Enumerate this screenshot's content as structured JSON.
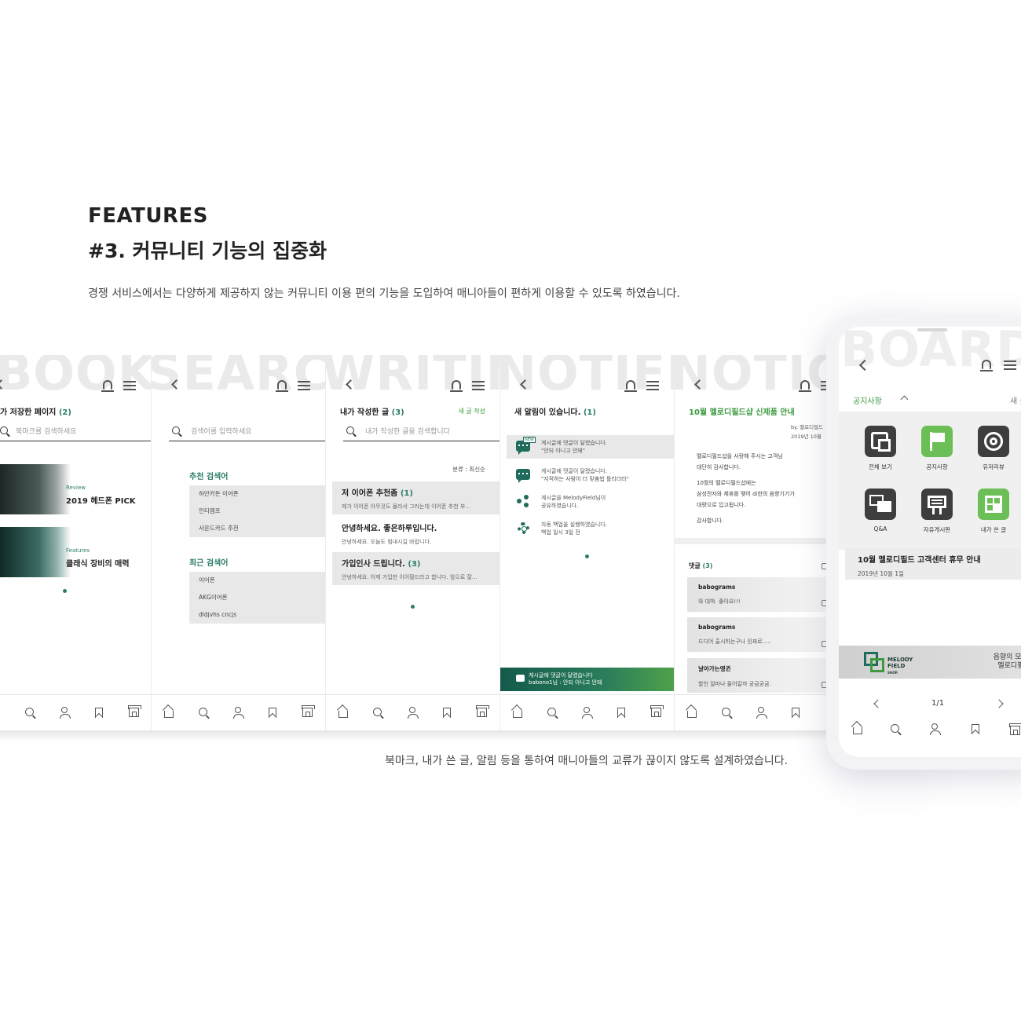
{
  "header": {
    "eyebrow": "FEATURES",
    "title": "#3. 커뮤니티 기능의 집중화",
    "description": "경쟁 서비스에서는 다양하게 제공하지 않는 커뮤니티 이용 편의 기능을 도입하여 매니아들이 편하게 이용할 수 있도록 하였습니다."
  },
  "footer": {
    "description": "북마크, 내가 쓴 글, 알림 등을 통하여 매니아들의 교류가 끊이지 않도록 설계하였습니다."
  },
  "colors": {
    "accent_teal": "#2e7d6b",
    "accent_green": "#3d9a3f",
    "icon_dark": "#3e3e3e",
    "icon_green": "#6cbf56"
  },
  "screens": {
    "bookmark": {
      "bg_word": "BOOKM",
      "title_prefix": "가 저장한 페이지",
      "title_count": "(2)",
      "search_placeholder": "북마크를 검색하세요",
      "cards": [
        {
          "category": "Review",
          "title": "2019 헤드폰 PICK"
        },
        {
          "category": "Features",
          "title": "클래식 장비의 매력"
        }
      ]
    },
    "search": {
      "bg_word": "SEARCH",
      "search_placeholder": "검색어를 입력하세요",
      "recommended_head": "추천 검색어",
      "recommended": [
        "하만카돈 이어폰",
        "인티앰프",
        "사운드카드 추천"
      ],
      "recent_head": "최근 검색어",
      "recent": [
        "이어폰",
        "AKG이어폰",
        "dldjvhs cncjs"
      ]
    },
    "writing": {
      "bg_word": "WRITING",
      "title_prefix": "내가 작성한 글",
      "title_count": "(3)",
      "new_post": "새 글 작성",
      "search_placeholder": "내가 작성한 글을 검색합니다",
      "sort": "분류 : 최신순",
      "posts": [
        {
          "title": "저 이어폰 추천좀",
          "count": "(1)",
          "body": "제가 이어폰 아무것도 몰라서 그러는데 이어폰 추천 부..."
        },
        {
          "title": "안녕하세요. 좋은하루입니다.",
          "count": "",
          "body": "안녕하세요. 오늘도 힘내시길 바랍니다."
        },
        {
          "title": "가입인사 드립니다.",
          "count": "(3)",
          "body": "안녕하세요. 어제 가입한 이어필드라고 합니다. 앞으로 잘..."
        }
      ]
    },
    "notification": {
      "bg_word": "NOTIFICA",
      "title_prefix": "새 알림이 있습니다.",
      "title_count": "(1)",
      "new_tag": "NEW",
      "items": [
        {
          "icon": "comment-bubble-icon",
          "line1": "게시글에 댓글이 달렸습니다.",
          "line2": "\"안되 아니고 안돼\""
        },
        {
          "icon": "comment-bubble-icon",
          "line1": "게시글에 댓글이 달렸습니다.",
          "line2": "\"지적하는 사람이 더 맞춤법 틀리더라\""
        },
        {
          "icon": "share-icon",
          "line1": "게시글을 MelodyField님이",
          "line2": "공유하였습니다."
        },
        {
          "icon": "gear-icon",
          "line1": "자동 백업을 실행하였습니다.",
          "line2": "백업 일시 3일 전"
        }
      ],
      "toast_line1": "게시글에 댓글이 달렸습니다",
      "toast_line2": "babono1님 : 안되 아니고 안돼"
    },
    "notice": {
      "bg_word": "NOTICE",
      "title": "10월 멜로디필드샵 신제품 안내",
      "by": "by. 멜로디필드",
      "date": "2019년 10월",
      "body": [
        "멜로디필드샵을 사랑해 주시는 고객님",
        "대단히 감사합니다.",
        "",
        "10월의 멜로디필드샵에는",
        "삼성전자와 제휴를 맺어 di한의 음향기기가",
        "대량으로 입고됩니다.",
        "",
        "감사합니다."
      ],
      "comments_head": "댓글",
      "comments_count": "(3)",
      "comments": [
        {
          "name": "babograms",
          "text": "와 대박. 좋아요!!!"
        },
        {
          "name": "babograms",
          "text": "드디어 출시하는구나 진짜로....."
        },
        {
          "name": "날아가는맹귄",
          "text": "할인 얼마나 들어갈까 궁금궁금."
        }
      ]
    },
    "board": {
      "bg_word": "BOARD",
      "selector": "공지사항",
      "new_write": "새 글쓰기",
      "apps": [
        {
          "label": "전체 보기",
          "icon": "all-view-icon",
          "color": "#3e3e3e"
        },
        {
          "label": "공지사항",
          "icon": "flag-icon",
          "color": "#6cbf56"
        },
        {
          "label": "유저리뷰",
          "icon": "review-icon",
          "color": "#3e3e3e"
        },
        {
          "label": "Q&A",
          "icon": "qa-icon",
          "color": "#3e3e3e"
        },
        {
          "label": "자유게시판",
          "icon": "free-board-icon",
          "color": "#3e3e3e"
        },
        {
          "label": "내가 쓴 글",
          "icon": "my-posts-icon",
          "color": "#6cbf56"
        }
      ],
      "notice_title": "10월 멜로디필드 고객센터 휴무 안내",
      "notice_date": "2019년 10월 1일",
      "banner_logo_line1": "MELODY",
      "banner_logo_line2": "FIELD",
      "banner_logo_line3": "SHOP.",
      "banner_text_line1": "음향의 모든것,",
      "banner_text_line2": "멜로디필드샵",
      "pager": "1/1"
    }
  }
}
